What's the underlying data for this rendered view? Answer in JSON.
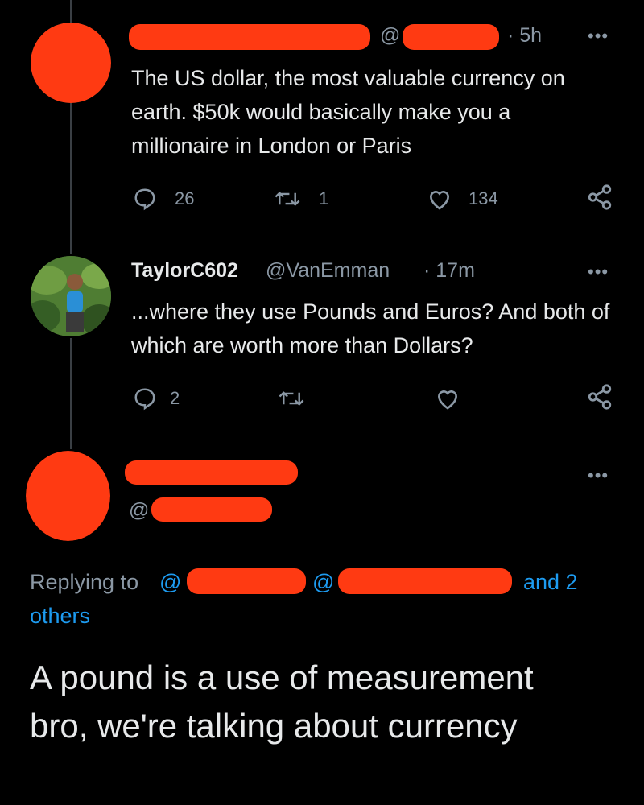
{
  "tweets": [
    {
      "handle_prefix": "@",
      "time": "· 5h",
      "text": "The US dollar, the most valuable currency on earth. $50k would basically make you a millionaire in London or Paris",
      "replies": "26",
      "retweets": "1",
      "likes": "134"
    },
    {
      "name": "TaylorC602",
      "handle": "@VanEmman",
      "time": "· 17m",
      "text": "...where they use Pounds and Euros? And both of which are worth more than Dollars?",
      "replies": "2"
    }
  ],
  "main_tweet": {
    "handle_prefix": "@",
    "replying_label": "Replying to",
    "mention1_prefix": "@",
    "mention2_prefix": "@",
    "and_others": "and 2",
    "others": "others",
    "text": "A pound is a use of measurement bro, we're talking about currency"
  },
  "more_icon": "•••",
  "colors": {
    "background": "#000000",
    "text": "#e7e9ea",
    "muted": "#8b98a5",
    "link": "#1d9bf0",
    "redaction": "#ff3a12"
  },
  "icons": [
    "reply-icon",
    "retweet-icon",
    "like-icon",
    "share-icon",
    "more-icon"
  ]
}
